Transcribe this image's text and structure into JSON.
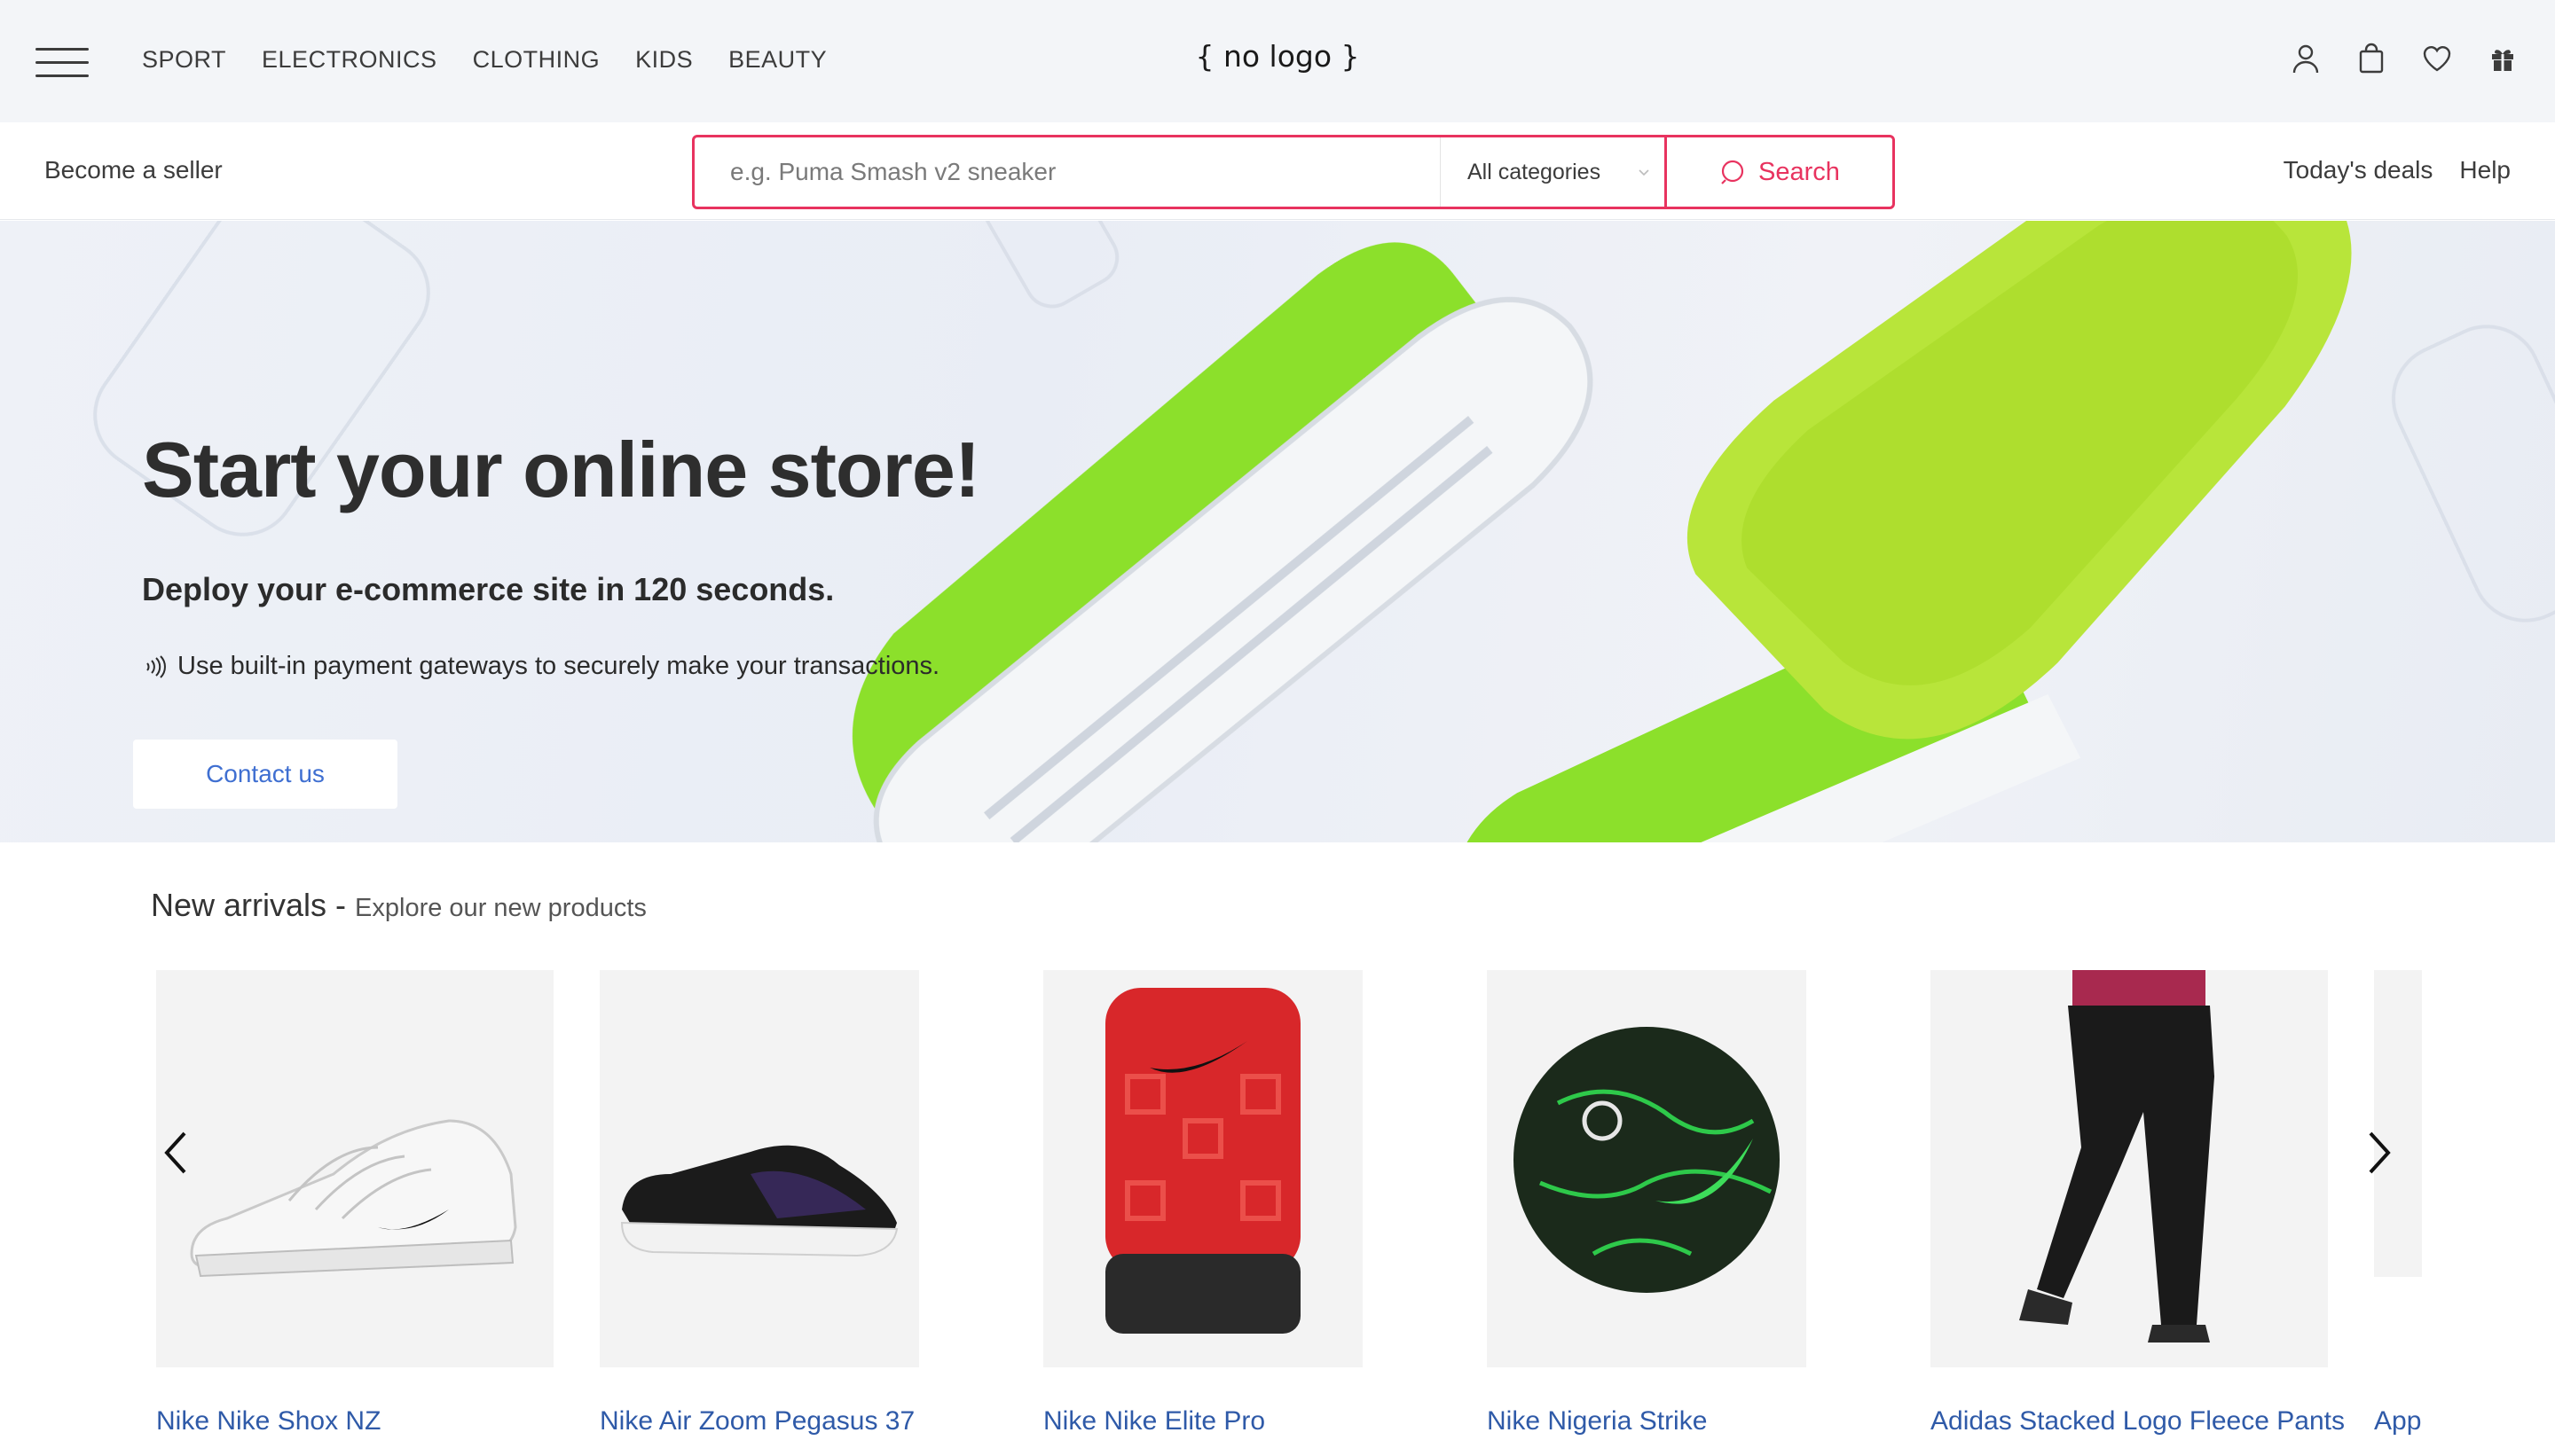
{
  "header": {
    "menu_icon": "hamburger-menu-icon",
    "categories": [
      "SPORT",
      "ELECTRONICS",
      "CLOTHING",
      "KIDS",
      "BEAUTY"
    ],
    "logo": "{ no logo }",
    "icons": [
      "user-icon",
      "shopping-bag-icon",
      "heart-icon",
      "gift-icon"
    ]
  },
  "subbar": {
    "become_seller": "Become a seller",
    "search": {
      "placeholder": "e.g. Puma Smash v2 sneaker",
      "category_selected": "All categories",
      "button_label": "Search"
    },
    "links": [
      "Today's deals",
      "Help"
    ]
  },
  "hero": {
    "title": "Start your online store!",
    "subtitle": "Deploy your e-commerce site in 120 seconds.",
    "note": "Use built-in payment gateways to securely make your transactions.",
    "cta": "Contact us"
  },
  "arrivals": {
    "heading": "New arrivals",
    "separator": "-",
    "subheading": "Explore our new products",
    "products": [
      {
        "name": "Nike Nike Shox NZ"
      },
      {
        "name": "Nike Air Zoom Pegasus 37"
      },
      {
        "name": "Nike Nike Elite Pro"
      },
      {
        "name": "Nike Nigeria Strike"
      },
      {
        "name": "Adidas Stacked Logo Fleece Pants"
      },
      {
        "name": "App"
      }
    ]
  },
  "colors": {
    "accent": "#e8335f",
    "link": "#2f5aa8",
    "cta_text": "#3f6fd1",
    "header_bg": "#f3f5f8"
  }
}
